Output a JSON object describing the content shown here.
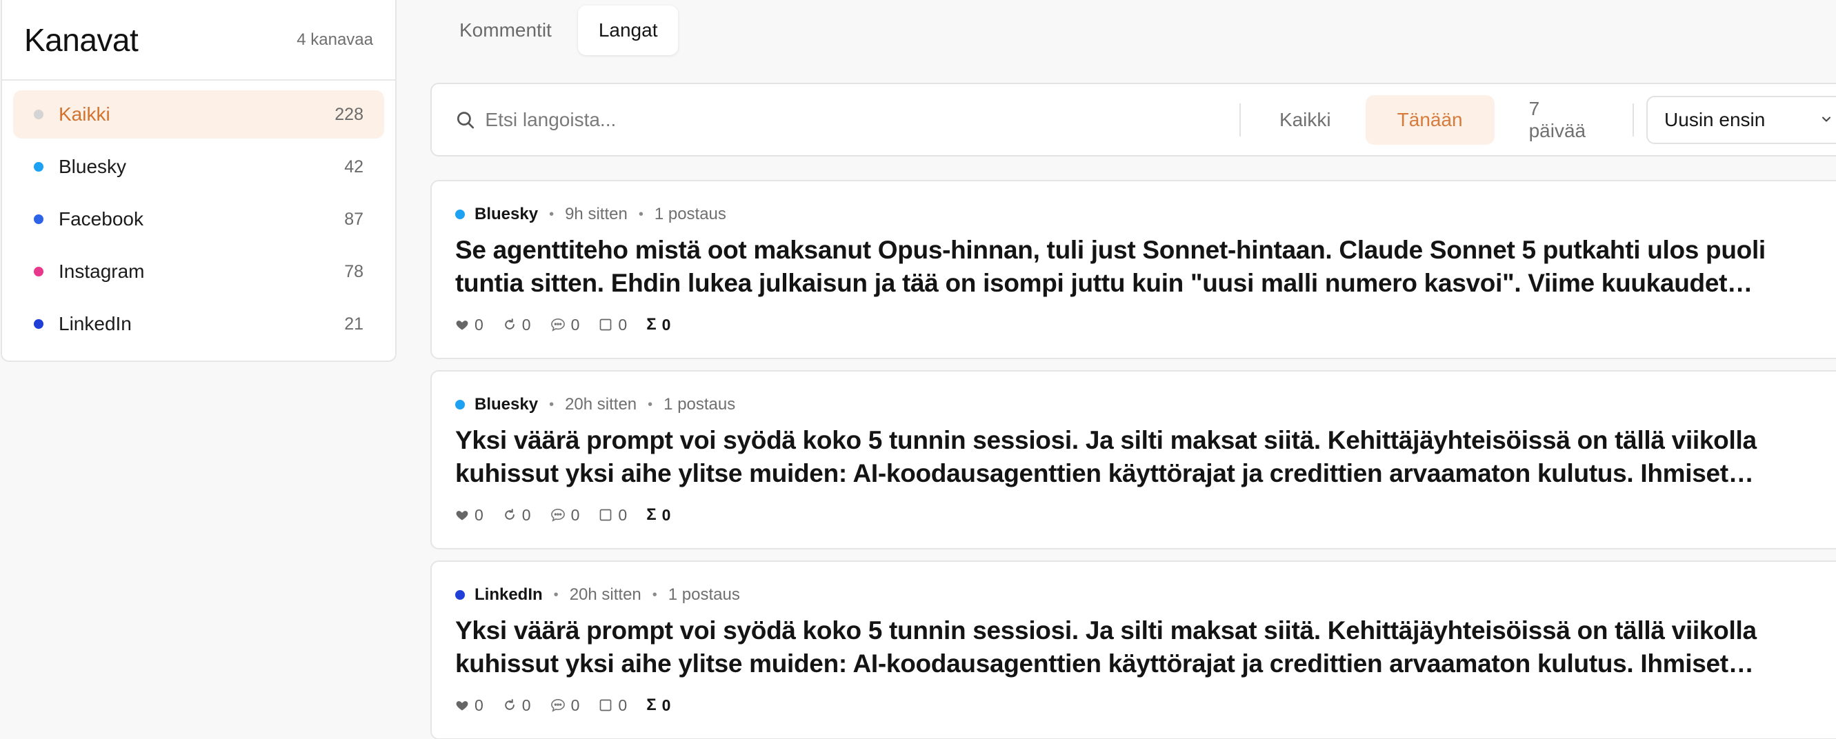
{
  "sidebar": {
    "title": "Kanavat",
    "count_label": "4 kanavaa",
    "channels": [
      {
        "label": "Kaikki",
        "count": "228",
        "color": "#d4d4d4",
        "active": true
      },
      {
        "label": "Bluesky",
        "count": "42",
        "color": "#1da1f2"
      },
      {
        "label": "Facebook",
        "count": "87",
        "color": "#2d63e8"
      },
      {
        "label": "Instagram",
        "count": "78",
        "color": "#e8388c"
      },
      {
        "label": "LinkedIn",
        "count": "21",
        "color": "#1f3fd6"
      }
    ]
  },
  "tabs": [
    {
      "label": "Kommentit"
    },
    {
      "label": "Langat",
      "active": true
    }
  ],
  "filters": {
    "search_placeholder": "Etsi langoista...",
    "ranges": [
      {
        "label": "Kaikki"
      },
      {
        "label": "Tänään",
        "active": true
      },
      {
        "label": "7 päivää"
      }
    ],
    "sort_value": "Uusin ensin"
  },
  "threads": [
    {
      "platform": "Bluesky",
      "platform_color": "#1da1f2",
      "time": "9h sitten",
      "posts": "1 postaus",
      "text": "Se agenttiteho mistä oot maksanut Opus-hinnan, tuli just Sonnet-hintaan. Claude Sonnet 5 putkahti ulos puoli tuntia sitten. Ehdin lukea julkaisun ja tää on isompi juttu kuin \"uusi malli numero kasvoi\". Viime kuukaudet hommattiin…",
      "stats": {
        "likes": "0",
        "reposts": "0",
        "replies": "0",
        "quotes": "0",
        "total": "0"
      }
    },
    {
      "platform": "Bluesky",
      "platform_color": "#1da1f2",
      "time": "20h sitten",
      "posts": "1 postaus",
      "text": "Yksi väärä prompt voi syödä koko 5 tunnin sessiosi. Ja silti maksat siitä. Kehittäjäyhteisöissä on tällä viikolla kuhissut yksi aihe ylitse muiden: AI-koodausagenttien käyttörajat ja credittien arvaamaton kulutus. Ihmiset…",
      "stats": {
        "likes": "0",
        "reposts": "0",
        "replies": "0",
        "quotes": "0",
        "total": "0"
      }
    },
    {
      "platform": "LinkedIn",
      "platform_color": "#1f3fd6",
      "time": "20h sitten",
      "posts": "1 postaus",
      "text": "Yksi väärä prompt voi syödä koko 5 tunnin sessiosi. Ja silti maksat siitä. Kehittäjäyhteisöissä on tällä viikolla kuhissut yksi aihe ylitse muiden: AI-koodausagenttien käyttörajat ja credittien arvaamaton kulutus. Ihmiset…",
      "stats": {
        "likes": "0",
        "reposts": "0",
        "replies": "0",
        "quotes": "0",
        "total": "0"
      }
    }
  ],
  "icons": {
    "search": "search-icon",
    "chevron": "chevron-down-icon",
    "like": "heart-icon",
    "repost": "repost-icon",
    "reply": "comment-icon",
    "quote": "square-icon",
    "sum": "sigma-icon"
  },
  "colors": {
    "accent": "#d77b3c",
    "accent_bg": "#fdf1e7"
  }
}
